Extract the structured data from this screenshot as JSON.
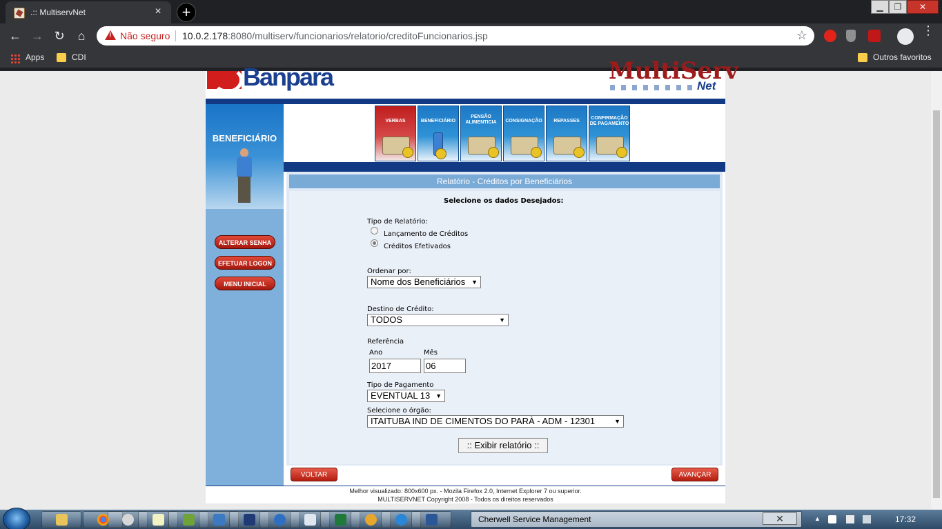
{
  "browser": {
    "tab_title": ".:: MultiservNet",
    "tab_close": "×",
    "new_tab": "+",
    "window_min": "▁",
    "window_max": "❐",
    "window_close": "✕",
    "security_label": "Não seguro",
    "url_host": "10.0.2.178",
    "url_rest": ":8080/multiserv/funcionarios/relatorio/creditoFuncionarios.jsp",
    "bookmarks": [
      "Apps",
      "CDI"
    ],
    "other_bookmarks": "Outros favoritos",
    "icons": [
      "back-icon",
      "forward-icon",
      "reload-icon",
      "home-icon",
      "warning-icon",
      "star-icon",
      "menu-icon"
    ]
  },
  "header": {
    "brand_left": "Banpara",
    "brand_right": "MultiServ",
    "brand_net": "Net"
  },
  "nav_tiles": [
    {
      "label": "VERBAS"
    },
    {
      "label": "BENEFICIÁRIO"
    },
    {
      "label": "PENSÃO ALIMENTICIA"
    },
    {
      "label": "CONSIGNAÇÃO"
    },
    {
      "label": "REPASSES"
    },
    {
      "label": "CONFIRMAÇÃO DE PAGAMENTO"
    }
  ],
  "sidebar": {
    "title": "BENEFICIÁRIO",
    "buttons": [
      "ALTERAR SENHA",
      "EFETUAR LOGON",
      "MENU INICIAL"
    ]
  },
  "form": {
    "header": "Relatório - Créditos por Beneficiários",
    "subtitle": "Selecione os dados Desejados:",
    "tipo_label": "Tipo de Relatório:",
    "tipo_options": [
      "Lançamento de Créditos",
      "Créditos Efetivados"
    ],
    "tipo_selected": 1,
    "ordenar_label": "Ordenar por:",
    "ordenar_value": "Nome dos Beneficiários",
    "destino_label": "Destino de Crédito:",
    "destino_value": "TODOS",
    "referencia_label": "Referência",
    "ano_label": "Ano",
    "ano_value": "2017",
    "mes_label": "Mês",
    "mes_value": "06",
    "tipo_pag_label": "Tipo de Pagamento",
    "tipo_pag_value": "EVENTUAL 13",
    "orgao_label": "Selecione o órgão:",
    "orgao_value": "ITAITUBA IND DE CIMENTOS DO PARÀ - ADM - 12301",
    "exibir_button": ":: Exibir relatório ::",
    "dropdown_arrow": "▼"
  },
  "nav_buttons": {
    "back": "VOLTAR",
    "next": "AVANÇAR"
  },
  "footer": {
    "line1": "Melhor visualizado: 800x600 px. - Mozila Firefox 2.0, Internet Explorer 7 ou superior.",
    "line2": "MULTISERVNET Copyright 2008 - Todos os direitos reservados"
  },
  "taskbar": {
    "window_title": "Cherwell Service Management",
    "window_close": "✕",
    "clock": "17:32"
  }
}
